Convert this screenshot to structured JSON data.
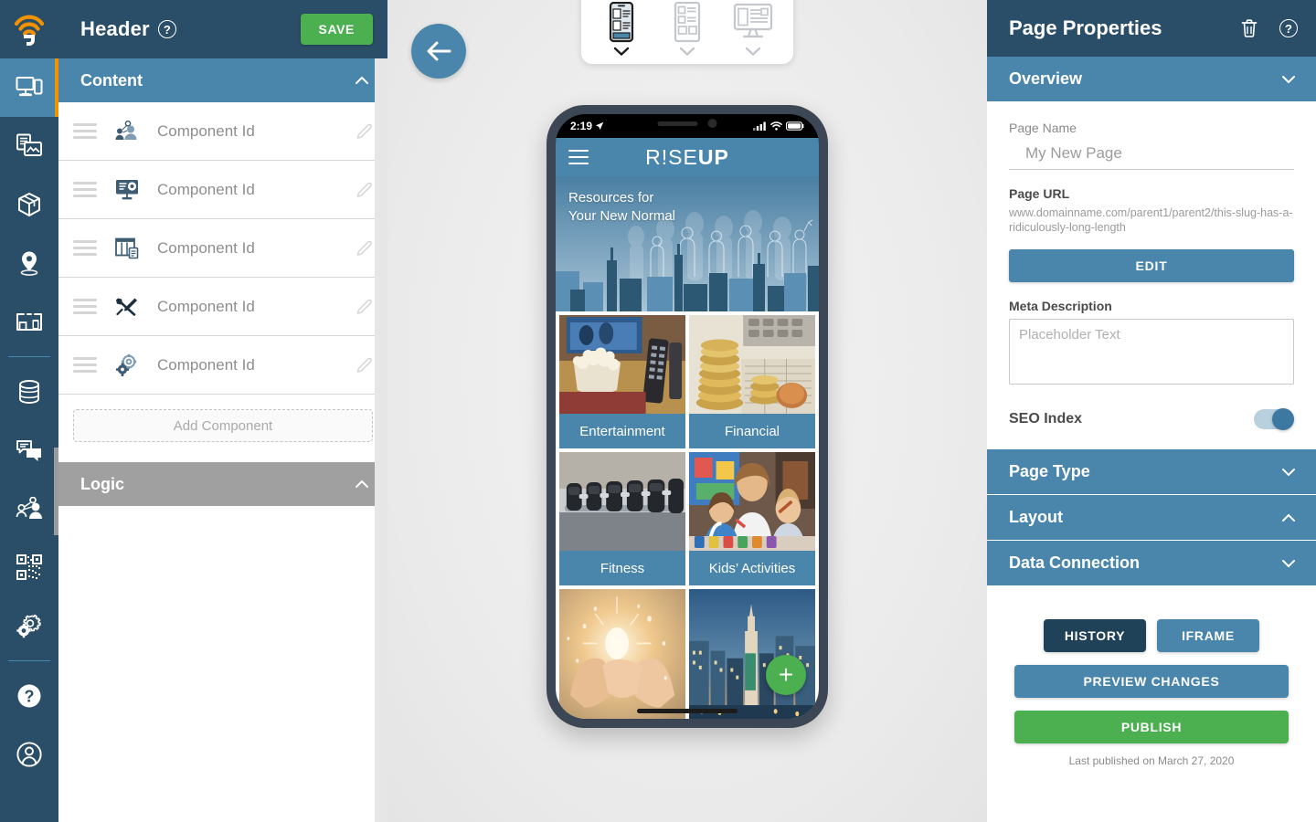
{
  "rail": {
    "logo_icon": "rise-wifi-logo-icon",
    "items": [
      {
        "icon": "devices-icon",
        "name": "sidebar-item-pages",
        "active": true
      },
      {
        "icon": "media-library-icon",
        "name": "sidebar-item-media",
        "active": false
      },
      {
        "icon": "package-box-icon",
        "name": "sidebar-item-components",
        "active": false
      },
      {
        "icon": "map-pin-icon",
        "name": "sidebar-item-locations",
        "active": false
      },
      {
        "icon": "kiosk-icon",
        "name": "sidebar-item-kiosk",
        "active": false
      },
      {
        "icon": "database-icon",
        "name": "sidebar-item-data",
        "active": false
      },
      {
        "icon": "chat-bubbles-icon",
        "name": "sidebar-item-messages",
        "active": false
      },
      {
        "icon": "users-group-icon",
        "name": "sidebar-item-users",
        "active": false
      },
      {
        "icon": "qr-code-icon",
        "name": "sidebar-item-qr-codes",
        "active": false
      },
      {
        "icon": "gears-icon",
        "name": "sidebar-item-settings",
        "active": false
      },
      {
        "icon": "help-circle-icon",
        "name": "sidebar-item-help",
        "active": false
      },
      {
        "icon": "account-icon",
        "name": "sidebar-item-account",
        "active": false
      }
    ]
  },
  "left_panel": {
    "title": "Header",
    "help_glyph": "?",
    "save_label": "SAVE",
    "content_section": {
      "label": "Content",
      "expanded": true
    },
    "logic_section": {
      "label": "Logic",
      "expanded": true
    },
    "components": [
      {
        "label": "Component Id",
        "icon": "presenter-audience-icon"
      },
      {
        "label": "Component Id",
        "icon": "monitor-settings-icon"
      },
      {
        "label": "Component Id",
        "icon": "layout-columns-icon"
      },
      {
        "label": "Component Id",
        "icon": "tools-wrench-screwdriver-icon"
      },
      {
        "label": "Component Id",
        "icon": "cogs-icon"
      }
    ],
    "add_component_label": "Add Component"
  },
  "canvas": {
    "back_button_icon": "arrow-left-icon",
    "device_options": [
      {
        "name": "device-mobile",
        "icon": "mobile-preview-icon",
        "active": true
      },
      {
        "name": "device-tablet",
        "icon": "tablet-preview-icon",
        "active": false
      },
      {
        "name": "device-desktop",
        "icon": "desktop-preview-icon",
        "active": false
      }
    ]
  },
  "preview": {
    "status_bar": {
      "time": "2:19",
      "location_icon": "location-arrow-icon",
      "signal_icon": "cellular-signal-icon",
      "wifi_icon": "wifi-icon",
      "battery_icon": "battery-icon"
    },
    "app_bar": {
      "menu_icon": "hamburger-menu-icon",
      "brand_thin": "R!SE",
      "brand_bold": "UP"
    },
    "hero": {
      "line1": "Resources for",
      "line2": "Your New Normal"
    },
    "tiles": [
      {
        "caption": "Entertainment",
        "image": "popcorn-tv-remote-photo"
      },
      {
        "caption": "Financial",
        "image": "coins-calculator-photo"
      },
      {
        "caption": "Fitness",
        "image": "dumbbell-rack-photo"
      },
      {
        "caption": "Kids’ Activities",
        "image": "mother-children-painting-photo"
      },
      {
        "caption": "",
        "image": "hands-light-photo"
      },
      {
        "caption": "",
        "image": "city-skyline-dusk-photo"
      }
    ],
    "fab": {
      "label": "+",
      "icon": "plus-icon"
    }
  },
  "right_panel": {
    "title": "Page Properties",
    "delete_icon": "trash-icon",
    "help_icon": "help-circle-icon",
    "help_glyph": "?",
    "overview": {
      "label": "Overview",
      "expanded": true
    },
    "page_name": {
      "label": "Page Name",
      "placeholder": "My New Page",
      "value": ""
    },
    "page_url": {
      "label": "Page URL",
      "value": "www.domainname.com/parent1/parent2/this-slug-has-a-ridiculously-long-length",
      "edit_label": "EDIT"
    },
    "meta_description": {
      "label": "Meta Description",
      "placeholder": "Placeholder Text",
      "value": ""
    },
    "seo_index": {
      "label": "SEO Index",
      "enabled": true
    },
    "sections": [
      {
        "label": "Page Type",
        "expanded": false
      },
      {
        "label": "Layout",
        "expanded": true
      },
      {
        "label": "Data Connection",
        "expanded": false
      }
    ],
    "actions": {
      "history": "HISTORY",
      "iframe": "IFRAME",
      "preview": "PREVIEW CHANGES",
      "publish": "PUBLISH"
    },
    "last_published": "Last published on March 27, 2020"
  },
  "colors": {
    "dark_navy": "#2b4e68",
    "blue": "#4a86ab",
    "green": "#4caf50",
    "orange_accent": "#f39200",
    "gray_logic": "#a0a0a0",
    "history_dark": "#1f4258"
  }
}
